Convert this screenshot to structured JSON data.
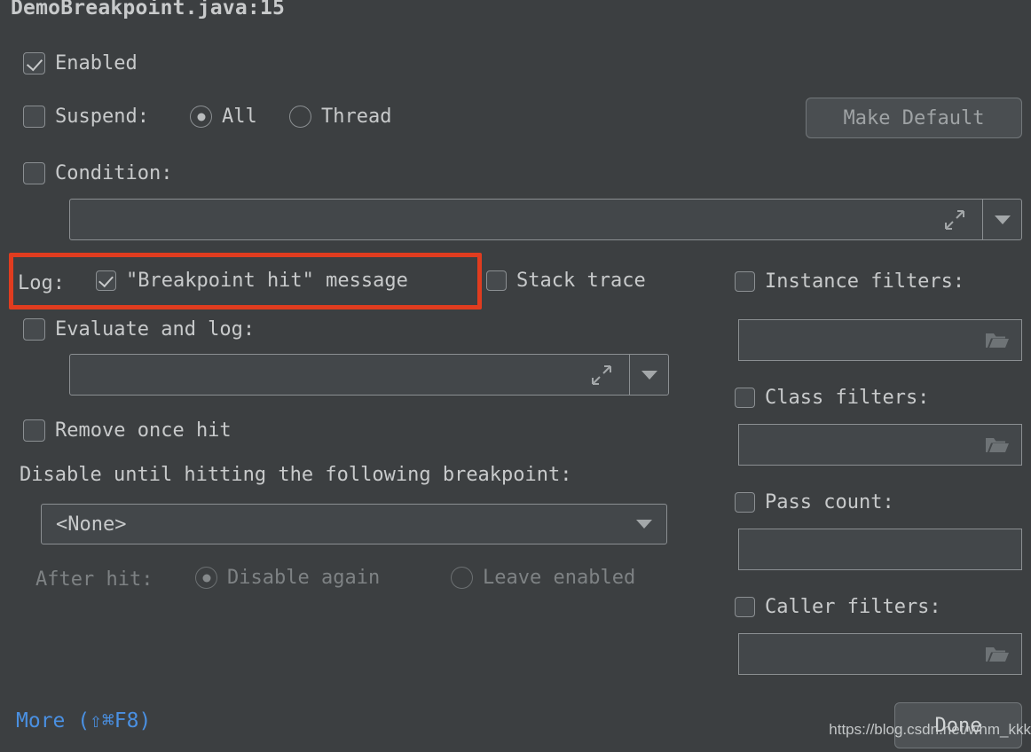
{
  "dialog": {
    "title": "DemoBreakpoint.java:15"
  },
  "left": {
    "enabled": {
      "label": "Enabled",
      "checked": true
    },
    "suspend": {
      "label": "Suspend:",
      "checked": false,
      "options": [
        {
          "label": "All",
          "selected": true
        },
        {
          "label": "Thread",
          "selected": false
        }
      ]
    },
    "condition": {
      "label": "Condition:",
      "checked": false,
      "value": "",
      "expand_icon": "expand-icon",
      "dropdown_icon": "chevron-down-icon"
    },
    "log": {
      "prefix": "Log:",
      "message": {
        "label": "\"Breakpoint hit\" message",
        "checked": true
      },
      "stack_trace": {
        "label": "Stack trace",
        "checked": false
      },
      "highlighted": true
    },
    "evaluate_and_log": {
      "label": "Evaluate and log:",
      "checked": false,
      "value": "",
      "expand_icon": "expand-icon",
      "dropdown_icon": "chevron-down-icon"
    },
    "remove_once_hit": {
      "label": "Remove once hit",
      "checked": false
    },
    "disable_until": {
      "label": "Disable until hitting the following breakpoint:",
      "selected": "<None>",
      "options": [
        "<None>"
      ]
    },
    "after_hit": {
      "label": "After hit:",
      "disabled": true,
      "options": [
        {
          "label": "Disable again",
          "selected": true
        },
        {
          "label": "Leave enabled",
          "selected": false
        }
      ]
    }
  },
  "right": {
    "make_default": {
      "label": "Make Default",
      "enabled": false
    },
    "instance_filters": {
      "label": "Instance filters:",
      "checked": false,
      "value": "",
      "icon": "folder-icon"
    },
    "class_filters": {
      "label": "Class filters:",
      "checked": false,
      "value": "",
      "icon": "folder-icon"
    },
    "pass_count": {
      "label": "Pass count:",
      "checked": false,
      "value": ""
    },
    "caller_filters": {
      "label": "Caller filters:",
      "checked": false,
      "value": "",
      "icon": "folder-icon"
    }
  },
  "footer": {
    "more": "More (⇧⌘F8)",
    "done": "Done",
    "watermark": "https://blog.csdn.net/whm_kkk"
  },
  "colors": {
    "background": "#3c3f41",
    "text": "#c8cacb",
    "text_dim": "#7e8284",
    "accent_link": "#4a90e2",
    "highlight_box": "#e03c1f",
    "field_bg": "#43474a",
    "border": "#8b8f92"
  }
}
